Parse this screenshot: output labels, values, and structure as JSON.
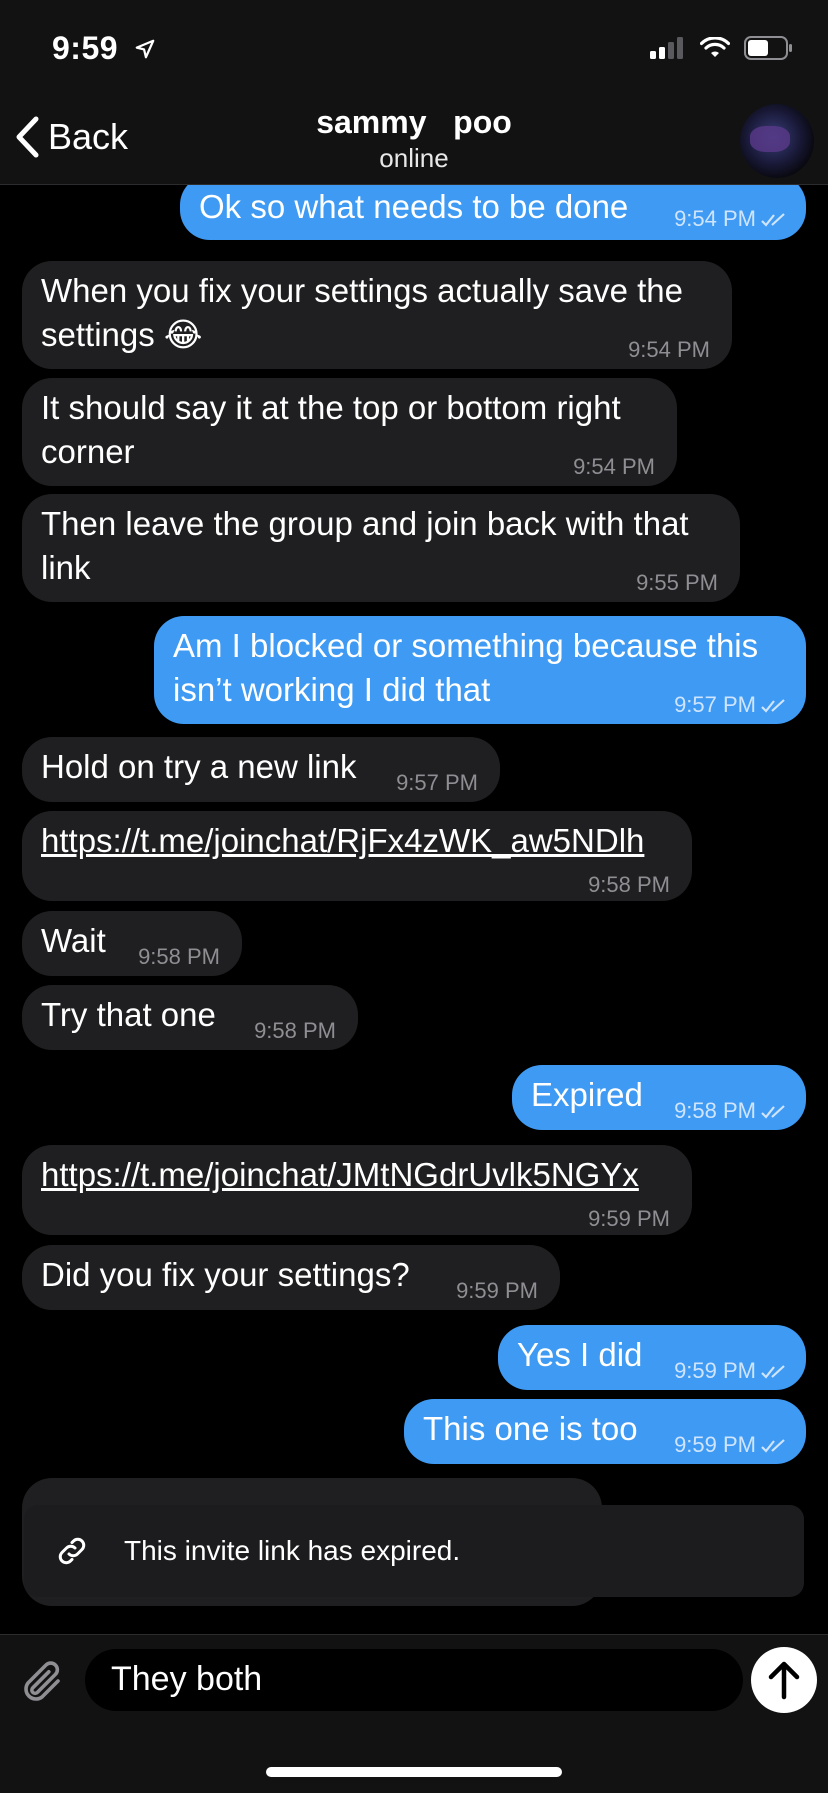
{
  "status": {
    "time": "9:59"
  },
  "header": {
    "back_label": "Back",
    "name": "sammy   poo",
    "subtitle": "online"
  },
  "messages": [
    {
      "dir": "out",
      "text": "Ok so what needs to be done",
      "time": "9:54 PM"
    },
    {
      "dir": "in",
      "text": "When you fix your settings actually save the\nsettings 😂",
      "time": "9:54 PM"
    },
    {
      "dir": "in",
      "text": "It should say it at the top or bottom right\ncorner",
      "time": "9:54 PM"
    },
    {
      "dir": "in",
      "text": "Then leave the group and join back with that\nlink",
      "time": "9:55 PM"
    },
    {
      "dir": "out",
      "text": "Am I blocked or something because this\nisn’t working I did that",
      "time": "9:57 PM"
    },
    {
      "dir": "in",
      "text": "Hold on try a new link",
      "time": "9:57 PM"
    },
    {
      "dir": "in",
      "text": "https://t.me/joinchat/RjFx4zWK_aw5NDlh",
      "time": "9:58 PM",
      "link": true
    },
    {
      "dir": "in",
      "text": "Wait",
      "time": "9:58 PM"
    },
    {
      "dir": "in",
      "text": "Try that one",
      "time": "9:58 PM"
    },
    {
      "dir": "out",
      "text": "Expired",
      "time": "9:58 PM"
    },
    {
      "dir": "in",
      "text": "https://t.me/joinchat/JMtNGdrUvlk5NGYx",
      "time": "9:59 PM",
      "link": true
    },
    {
      "dir": "in",
      "text": "Did you fix your settings?",
      "time": "9:59 PM"
    },
    {
      "dir": "out",
      "text": "Yes I did",
      "time": "9:59 PM"
    },
    {
      "dir": "out",
      "text": "This one is too",
      "time": "9:59 PM"
    }
  ],
  "toast": {
    "text": "This invite link has expired.",
    "icon": "link-icon"
  },
  "composer": {
    "value": "They both",
    "attach_icon": "paperclip-icon",
    "send_icon": "send-arrow-icon"
  },
  "colors": {
    "outgoing": "#3e9af3",
    "incoming": "#1f1f21",
    "background": "#000000"
  }
}
